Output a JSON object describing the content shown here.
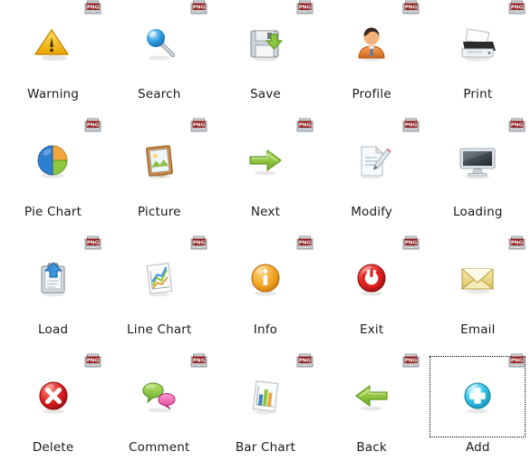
{
  "window": {
    "view": "icon-grid",
    "columns": 5,
    "rows": 4,
    "background_color": "#ffffff",
    "label_color": "#1a1a1a",
    "selection_border_color": "#000000"
  },
  "file_badge": {
    "text": "PNG",
    "icon": "png-file-badge-icon",
    "body_color": "#8c1919",
    "text_color": "#ffffff",
    "frame_color": "#b0b0b0"
  },
  "items": [
    {
      "label": "Warning",
      "icon": "warning-triangle-icon",
      "badge": "PNG",
      "selected": false,
      "colors": {
        "primary": "#f5c518",
        "secondary": "#d19a00"
      }
    },
    {
      "label": "Search",
      "icon": "magnifier-icon",
      "badge": "PNG",
      "selected": false,
      "colors": {
        "primary": "#2f9fe0",
        "secondary": "#8a8a8a"
      }
    },
    {
      "label": "Save",
      "icon": "floppy-disk-save-icon",
      "badge": "PNG",
      "selected": false,
      "colors": {
        "primary": "#cfd4d8",
        "secondary": "#76bb27"
      }
    },
    {
      "label": "Profile",
      "icon": "user-profile-icon",
      "badge": "PNG",
      "selected": false,
      "colors": {
        "primary": "#e07b2a",
        "secondary": "#3a2a22"
      }
    },
    {
      "label": "Print",
      "icon": "printer-icon",
      "badge": "PNG",
      "selected": false,
      "colors": {
        "primary": "#e9ecef",
        "secondary": "#2b2b2b"
      }
    },
    {
      "label": "Pie Chart",
      "icon": "pie-chart-icon",
      "badge": "PNG",
      "selected": false,
      "colors": {
        "primary": "#2f7fd0",
        "secondary": "#7ebf3f"
      }
    },
    {
      "label": "Picture",
      "icon": "picture-frame-icon",
      "badge": "PNG",
      "selected": false,
      "colors": {
        "primary": "#c98a4b",
        "secondary": "#8fc04a"
      }
    },
    {
      "label": "Next",
      "icon": "arrow-right-icon",
      "badge": "PNG",
      "selected": false,
      "colors": {
        "primary": "#8dc63f",
        "secondary": "#5e9c22"
      }
    },
    {
      "label": "Modify",
      "icon": "document-pencil-icon",
      "badge": "PNG",
      "selected": false,
      "colors": {
        "primary": "#f2f4f6",
        "secondary": "#b9c0c6"
      }
    },
    {
      "label": "Loading",
      "icon": "monitor-icon",
      "badge": "PNG",
      "selected": false,
      "colors": {
        "primary": "#dfe4e8",
        "secondary": "#5a6670"
      }
    },
    {
      "label": "Load",
      "icon": "clipboard-upload-icon",
      "badge": "PNG",
      "selected": false,
      "colors": {
        "primary": "#d7dbde",
        "secondary": "#2f8ed6"
      }
    },
    {
      "label": "Line Chart",
      "icon": "line-chart-icon",
      "badge": "PNG",
      "selected": false,
      "colors": {
        "primary": "#f7f8f9",
        "secondary": "#7ebf3f"
      }
    },
    {
      "label": "Info",
      "icon": "info-circle-icon",
      "badge": "PNG",
      "selected": false,
      "colors": {
        "primary": "#f5a623",
        "secondary": "#ffffff"
      }
    },
    {
      "label": "Exit",
      "icon": "power-off-icon",
      "badge": "PNG",
      "selected": false,
      "colors": {
        "primary": "#d82020",
        "secondary": "#ffffff"
      }
    },
    {
      "label": "Email",
      "icon": "envelope-icon",
      "badge": "PNG",
      "selected": false,
      "colors": {
        "primary": "#efdc8c",
        "secondary": "#d6bf62"
      }
    },
    {
      "label": "Delete",
      "icon": "delete-circle-x-icon",
      "badge": "PNG",
      "selected": false,
      "colors": {
        "primary": "#d82020",
        "secondary": "#ffffff"
      }
    },
    {
      "label": "Comment",
      "icon": "speech-bubbles-icon",
      "badge": "PNG",
      "selected": false,
      "colors": {
        "primary": "#8dc63f",
        "secondary": "#ea5fa8"
      }
    },
    {
      "label": "Bar Chart",
      "icon": "bar-chart-icon",
      "badge": "PNG",
      "selected": false,
      "colors": {
        "primary": "#f7f8f9",
        "secondary": "#3a7fc1"
      }
    },
    {
      "label": "Back",
      "icon": "arrow-left-icon",
      "badge": "PNG",
      "selected": false,
      "colors": {
        "primary": "#8dc63f",
        "secondary": "#5e9c22"
      }
    },
    {
      "label": "Add",
      "icon": "add-circle-plus-icon",
      "badge": "PNG",
      "selected": true,
      "colors": {
        "primary": "#35c3e8",
        "secondary": "#ffffff"
      }
    }
  ]
}
